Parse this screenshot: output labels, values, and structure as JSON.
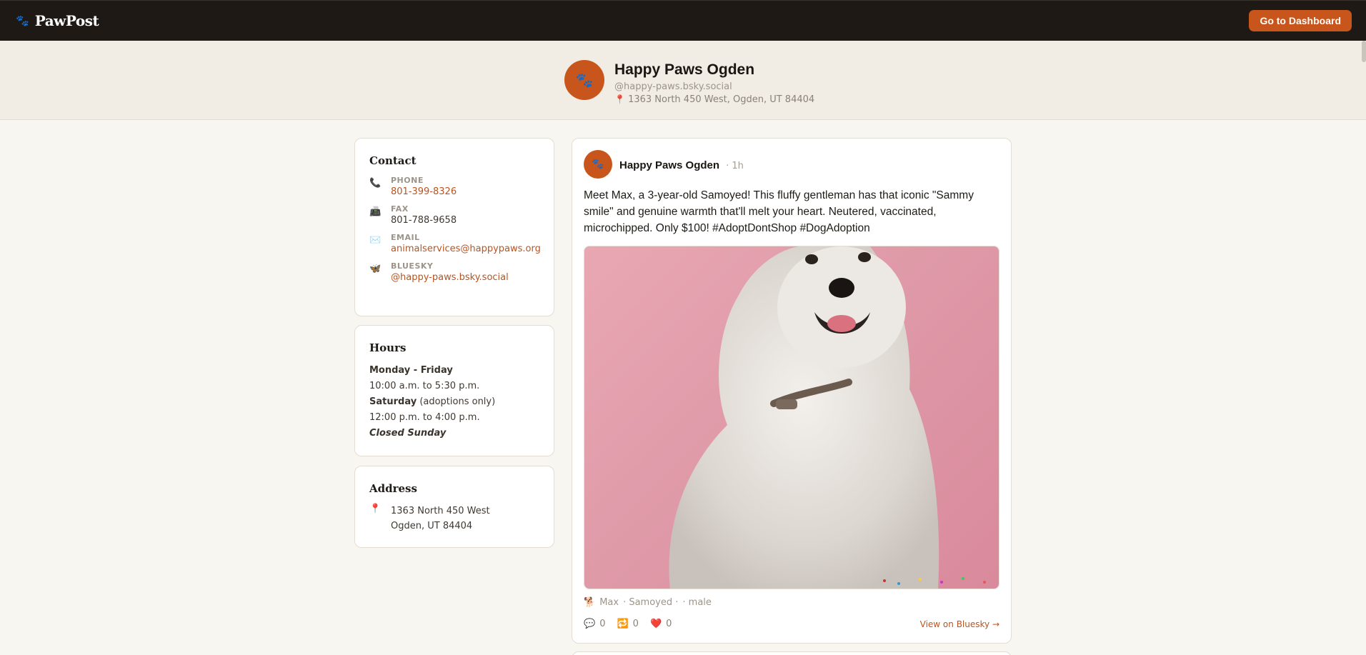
{
  "topbar": {
    "brand_icon": "paw-icon",
    "brand": "PawPost",
    "dashboard_button": "Go to Dashboard"
  },
  "profile": {
    "name": "Happy Paws Ogden",
    "handle": "@happy-paws.bsky.social",
    "address": "1363 North 450 West, Ogden, UT 84404"
  },
  "contact": {
    "title": "Contact",
    "items": [
      {
        "icon": "phone-icon",
        "label": "PHONE",
        "value": "801-399-8326"
      },
      {
        "icon": "fax-icon",
        "label": "FAX",
        "value": "801-788-9658"
      },
      {
        "icon": "email-icon",
        "label": "EMAIL",
        "value": "animalservices@happypaws.org"
      },
      {
        "icon": "butterfly-icon",
        "label": "BLUESKY",
        "value": "@happy-paws.bsky.social"
      }
    ]
  },
  "hours": {
    "title": "Hours",
    "weekday_label": "Monday - Friday",
    "weekday_hours": "10:00 a.m. to 5:30 p.m.",
    "saturday_label": "Saturday",
    "saturday_note": "(adoptions only)",
    "saturday_hours": "12:00 p.m. to 4:00 p.m.",
    "closed": "Closed Sunday"
  },
  "address": {
    "title": "Address",
    "line1": "1363 North 450 West",
    "line2": "Ogden, UT 84404"
  },
  "post": {
    "author": "Happy Paws Ogden",
    "time": "· 1h",
    "text": "Meet Max, a 3-year-old Samoyed! This fluffy gentleman has that iconic \"Sammy smile\" and genuine warmth that'll melt your heart. Neutered, vaccinated, microchipped. Only $100! #AdoptDontShop #DogAdoption",
    "meta_name": "Max",
    "meta_breed": "· Samoyed ·",
    "meta_sex": "· male",
    "replies": "0",
    "reposts": "0",
    "likes": "0",
    "view_link": "View on Bluesky →"
  },
  "colors": {
    "accent": "#c8551c",
    "topbar": "#1e1914",
    "background": "#f8f6f1"
  }
}
